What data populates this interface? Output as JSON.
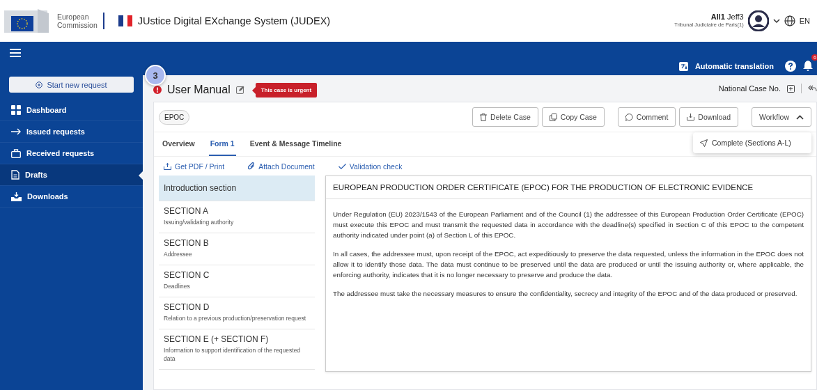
{
  "header": {
    "org_line1": "European",
    "org_line2": "Commission",
    "app_title": "JUstice Digital EXchange System (JUDEX)",
    "user_first": "All1",
    "user_last": "Jeff3",
    "user_court": "Tribunal Judiciaire de Paris(1)",
    "language": "EN"
  },
  "topbar": {
    "translation": "Automatic translation",
    "notification_count": "6"
  },
  "sidebar": {
    "start_button": "Start new request",
    "items": [
      {
        "label": "Dashboard",
        "selected": false
      },
      {
        "label": "Issued requests",
        "selected": false
      },
      {
        "label": "Received requests",
        "selected": false
      },
      {
        "label": "Drafts",
        "selected": true
      },
      {
        "label": "Downloads",
        "selected": false
      }
    ]
  },
  "step_badge": "3",
  "case": {
    "title": "User Manual",
    "urgent": true,
    "urgent_label": "This case is urgent",
    "national_case_label": "National Case No.",
    "tag": "EPOC",
    "buttons": [
      "Delete Case",
      "Copy Case",
      "Comment",
      "Download"
    ],
    "workflow": {
      "label": "Workflow",
      "expanded": true,
      "menu_items": [
        "Complete (Sections A-L)"
      ]
    },
    "tabs": [
      {
        "label": "Overview",
        "selected": false
      },
      {
        "label": "Form 1",
        "selected": true
      },
      {
        "label": "Event & Message Timeline",
        "selected": false
      }
    ],
    "actions": [
      "Get PDF / Print",
      "Attach Document",
      "Validation check"
    ],
    "sections": [
      {
        "title": "Introduction section",
        "selected": true
      },
      {
        "title": "SECTION A",
        "subtitle": "Issuing/validating authority",
        "selected": false
      },
      {
        "title": "SECTION B",
        "subtitle": "Addressee",
        "selected": false
      },
      {
        "title": "SECTION C",
        "subtitle": "Deadlines",
        "selected": false
      },
      {
        "title": "SECTION D",
        "subtitle": "Relation to a previous production/preservation request",
        "selected": false
      },
      {
        "title": "SECTION E (+ SECTION F)",
        "subtitle": "Information to support identification of the requested data",
        "selected": false
      }
    ],
    "panel": {
      "heading": "EUROPEAN PRODUCTION ORDER CERTIFICATE (EPOC) FOR THE PRODUCTION OF ELECTRONIC EVIDENCE",
      "paragraphs": [
        "Under Regulation (EU) 2023/1543 of the European Parliament and of the Council (1) the addressee of this European Production Order Certificate (EPOC) must execute this EPOC and must transmit the requested data in accordance with the deadline(s) specified in Section C of this EPOC to the competent authority indicated under point (a) of Section L of this EPOC.",
        "In all cases, the addressee must, upon receipt of the EPOC, act expeditiously to preserve the data requested, unless the information in the EPOC does not allow it to identify those data. The data must continue to be preserved until the data are produced or until the issuing authority or, where applicable, the enforcing authority, indicates that it is no longer necessary to preserve and produce the data.",
        "The addressee must take the necessary measures to ensure the confidentiality, secrecy and integrity of the EPOC and of the data produced or preserved."
      ]
    }
  }
}
